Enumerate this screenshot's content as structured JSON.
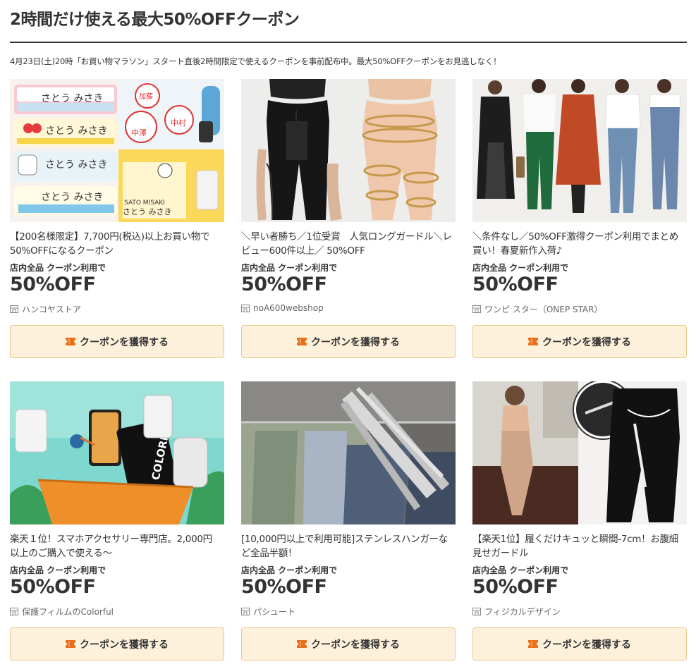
{
  "page": {
    "title": "2時間だけ使える最大50%OFFクーポン",
    "subtitle": "4月23日(土)20時「お買い物マラソン」スタート直後2時間限定で使えるクーポンを事前配布中。最大50%OFFクーポンをお見逃しなく！"
  },
  "button_label": "クーポンを獲得する",
  "colors": {
    "button_bg": "#fdf1dc",
    "button_border": "#e9c78c",
    "ticket": "#e8701a"
  },
  "cards": [
    {
      "title": "【200名様限定】7,700円(税込)以上お買い物で50%OFFになるクーポン",
      "condition": "店内全品 クーポン利用で",
      "discount": "50%OFF",
      "shop": "ハンコヤストア",
      "image_text": [
        "さとう みさき",
        "さとう みさき",
        "さとう みさき",
        "さとう みさき",
        "加藤",
        "中村",
        "中澤",
        "SATO MISAKI",
        "さとう みさき"
      ]
    },
    {
      "title": "＼早い者勝ち／1位受賞　人気ロングガードル＼レビュー600件以上／ 50%OFF",
      "condition": "店内全品 クーポン利用で",
      "discount": "50%OFF",
      "shop": "noA600webshop",
      "image_text": []
    },
    {
      "title": "＼条件なし／50%OFF激得クーポン利用でまとめ買い！春夏新作入荷♪",
      "condition": "店内全品 クーポン利用で",
      "discount": "50%OFF",
      "shop": "ワンピ スター（ONEP STAR）",
      "image_text": []
    },
    {
      "title": "楽天１位！スマホアクセサリー専門店。2,000円以上のご購入で使える～",
      "condition": "店内全品 クーポン利用で",
      "discount": "50%OFF",
      "shop": "保護フィルムのColorful",
      "image_text": [
        "COLORFUL"
      ]
    },
    {
      "title": "[10,000円以上で利用可能]ステンレスハンガーなど全品半額！",
      "condition": "店内全品 クーポン利用で",
      "discount": "50%OFF",
      "shop": "パシュート",
      "image_text": []
    },
    {
      "title": "【楽天1位】履くだけキュッと瞬間-7cm！お腹細見せガードル",
      "condition": "店内全品 クーポン利用で",
      "discount": "50%OFF",
      "shop": "フィジカルデザイン",
      "image_text": []
    }
  ]
}
